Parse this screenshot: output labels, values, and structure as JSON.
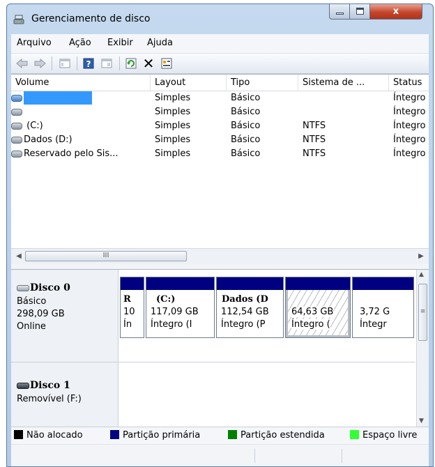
{
  "window": {
    "title": "Gerenciamento de disco",
    "close_label": "x"
  },
  "menu": [
    {
      "label": "Arquivo"
    },
    {
      "label": "Ação"
    },
    {
      "label": "Exibir"
    },
    {
      "label": "Ajuda"
    }
  ],
  "toolbar": {
    "icons": [
      "back-arrow-icon",
      "forward-arrow-icon",
      "console-tree-icon",
      "help-icon",
      "show-pane-icon",
      "refresh-icon",
      "delete-icon",
      "properties-icon"
    ],
    "delete_glyph": "✕",
    "help_glyph": "?"
  },
  "volume_list": {
    "columns": [
      "Volume",
      "Layout",
      "Tipo",
      "Sistema de ...",
      "Status"
    ],
    "rows": [
      {
        "volume": "",
        "layout": "Simples",
        "tipo": "Básico",
        "fs": "",
        "status": "Íntegro",
        "selected": true
      },
      {
        "volume": "",
        "layout": "Simples",
        "tipo": "Básico",
        "fs": "",
        "status": "Íntegro"
      },
      {
        "volume": "(C:)",
        "layout": "Simples",
        "tipo": "Básico",
        "fs": "NTFS",
        "status": "Íntegro"
      },
      {
        "volume": "Dados (D:)",
        "layout": "Simples",
        "tipo": "Básico",
        "fs": "NTFS",
        "status": "Íntegro"
      },
      {
        "volume": "Reservado pelo Sis...",
        "layout": "Simples",
        "tipo": "Básico",
        "fs": "NTFS",
        "status": "Íntegro"
      }
    ],
    "hscroll_thumb_glyph": "III"
  },
  "disks": [
    {
      "name": "Disco 0",
      "type": "Básico",
      "size": "298,09 GB",
      "state": "Online",
      "partitions": [
        {
          "line1": "R",
          "line2": "10",
          "line3": "Ín"
        },
        {
          "line1": "(C:)",
          "line2": "117,09 GB",
          "line3": "Íntegro (I"
        },
        {
          "line1": "Dados (D",
          "line2": "112,54 GB",
          "line3": "Íntegro (P"
        },
        {
          "line1": "",
          "line2": "64,63 GB",
          "line3": "Íntegro (",
          "selected": true
        },
        {
          "line1": "",
          "line2": "3,72 G",
          "line3": "Íntegr"
        }
      ]
    },
    {
      "name": "Disco 1",
      "type": "Removível (F:)"
    }
  ],
  "legend": [
    {
      "label": "Não alocado",
      "color": "#000000"
    },
    {
      "label": "Partição primária",
      "color": "#000080"
    },
    {
      "label": "Partição estendida",
      "color": "#008000"
    },
    {
      "label": "Espaço livre",
      "color": "#33ff33"
    }
  ],
  "colors": {
    "primary_partition_bar": "#000080",
    "selection": "#3399ff"
  }
}
